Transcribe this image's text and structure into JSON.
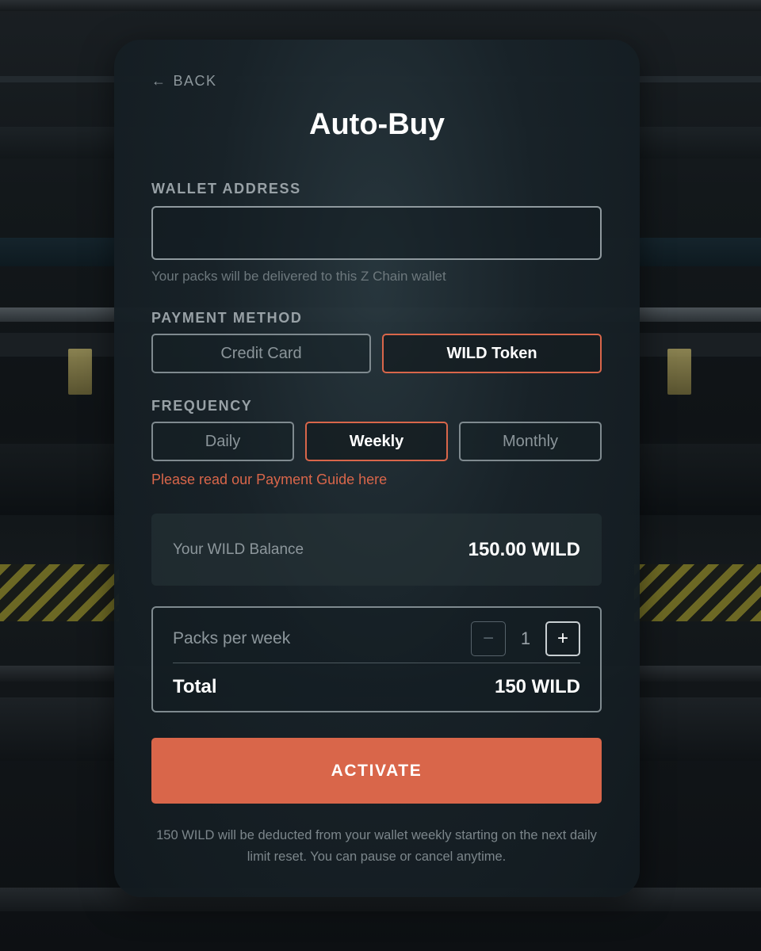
{
  "header": {
    "back_label": "BACK",
    "back_icon": "arrow-left-icon",
    "title": "Auto-Buy"
  },
  "wallet": {
    "label": "WALLET ADDRESS",
    "value": "",
    "placeholder": "",
    "hint": "Your packs will be delivered to this Z Chain wallet"
  },
  "payment": {
    "label": "PAYMENT METHOD",
    "options": [
      {
        "label": "Credit Card",
        "selected": false
      },
      {
        "label": "WILD Token",
        "selected": true
      }
    ]
  },
  "frequency": {
    "label": "FREQUENCY",
    "options": [
      {
        "label": "Daily",
        "selected": false
      },
      {
        "label": "Weekly",
        "selected": true
      },
      {
        "label": "Monthly",
        "selected": false
      }
    ],
    "guide_link": "Please read our Payment Guide here"
  },
  "balance": {
    "label": "Your WILD Balance",
    "value": "150.00 WILD"
  },
  "order": {
    "packs_label": "Packs per week",
    "quantity": "1",
    "minus_symbol": "−",
    "plus_symbol": "+",
    "total_label": "Total",
    "total_value": "150 WILD"
  },
  "activate_label": "ACTIVATE",
  "footnote": "150 WILD will be deducted from your wallet weekly starting on the next daily limit reset. You can pause or cancel anytime.",
  "colors": {
    "accent": "#d9664a",
    "card_background": "#18232a",
    "text_primary": "#ffffff",
    "text_muted": "#8d979c"
  }
}
